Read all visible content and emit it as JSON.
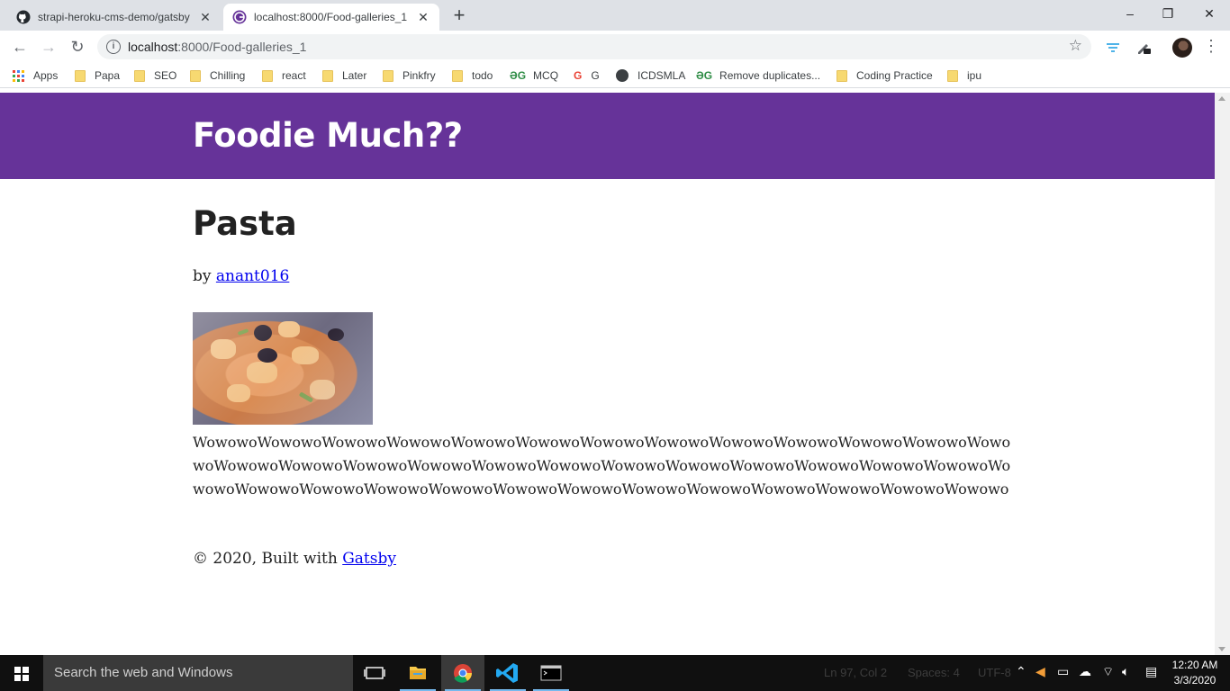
{
  "browser": {
    "tabs": [
      {
        "title": "strapi-heroku-cms-demo/gatsby",
        "favicon": "github-icon"
      },
      {
        "title": "localhost:8000/Food-galleries_1",
        "favicon": "gatsby-icon"
      }
    ],
    "window_controls": {
      "minimize": "–",
      "restore": "❐",
      "close": "✕"
    },
    "toolbar": {
      "back": "←",
      "forward": "→",
      "reload": "↻",
      "url_host": "localhost",
      "url_path": ":8000/Food-galleries_1",
      "star": "☆",
      "menu": "⋮"
    },
    "bookmarks": [
      {
        "label": "Apps",
        "icon": "apps-grid-icon"
      },
      {
        "label": "Papa",
        "icon": "folder-icon"
      },
      {
        "label": "SEO",
        "icon": "folder-icon"
      },
      {
        "label": "Chilling",
        "icon": "folder-icon"
      },
      {
        "label": "react",
        "icon": "folder-icon"
      },
      {
        "label": "Later",
        "icon": "folder-icon"
      },
      {
        "label": "Pinkfry",
        "icon": "folder-icon"
      },
      {
        "label": "todo",
        "icon": "folder-icon"
      },
      {
        "label": "MCQ",
        "icon": "geeksforgeeks-icon"
      },
      {
        "label": "G",
        "icon": "google-icon"
      },
      {
        "label": "ICDSMLA",
        "icon": "globe-icon"
      },
      {
        "label": "Remove duplicates...",
        "icon": "geeksforgeeks-icon"
      },
      {
        "label": "Coding Practice",
        "icon": "folder-icon"
      },
      {
        "label": "ipu",
        "icon": "folder-icon"
      }
    ]
  },
  "page": {
    "site_title": "Foodie Much??",
    "post_title": "Pasta",
    "byline_prefix": "by ",
    "author": "anant016",
    "image_alt": "pasta-photo",
    "body_text": "WowowoWowowoWowowoWowowoWowowoWowowoWowowoWowowoWowowoWowowoWowowoWowowoWowowoWowowoWowowoWowowoWowowoWowowoWowowoWowowoWowowoWowowoWowowoWowowoWowowoWowowoWowowoWowowoWowowoWowowoWowowoWowowoWowowoWowowoWowowoWowowoWowowoWowowo",
    "footer_prefix": "© 2020, Built with ",
    "footer_link": "Gatsby"
  },
  "taskbar": {
    "search_placeholder": "Search the web and Windows",
    "background_text": {
      "ln_col": "Ln 97, Col 2",
      "spaces": "Spaces: 4",
      "encoding": "UTF-8"
    },
    "time": "12:20 AM",
    "date": "3/3/2020"
  },
  "colors": {
    "header_purple": "#663399",
    "link_blue": "#0000ee",
    "taskbar_bg": "#101010"
  }
}
